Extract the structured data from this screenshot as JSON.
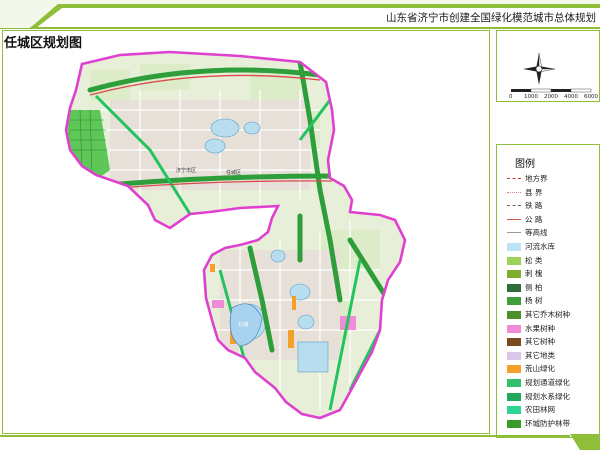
{
  "header": {
    "title": "山东省济宁市创建全国绿化模范城市总体规划"
  },
  "map": {
    "title": "任城区规划图",
    "place_labels": [
      "济宁市区",
      "任城区"
    ],
    "lake_label": "北湖"
  },
  "scale_bar": {
    "ticks": [
      "0",
      "1000",
      "2000",
      "4000",
      "6000"
    ]
  },
  "legend": {
    "title": "图例",
    "items": [
      {
        "label": "地方界",
        "kind": "line",
        "color": "#c0392b",
        "style": "dashed"
      },
      {
        "label": "县 界",
        "kind": "line",
        "color": "#c88",
        "style": "dotted"
      },
      {
        "label": "铁 路",
        "kind": "line",
        "color": "#666",
        "style": "dashed"
      },
      {
        "label": "公 路",
        "kind": "line",
        "color": "#d9534f",
        "style": "solid"
      },
      {
        "label": "等高线",
        "kind": "line",
        "color": "#999",
        "style": "solid"
      },
      {
        "label": "河流水库",
        "kind": "swatch",
        "color": "#bde3f4"
      },
      {
        "label": "松 类",
        "kind": "swatch",
        "color": "#9bd35b"
      },
      {
        "label": "刺 槐",
        "kind": "swatch",
        "color": "#7fae2f"
      },
      {
        "label": "侧 柏",
        "kind": "swatch",
        "color": "#2f6e3a"
      },
      {
        "label": "杨 树",
        "kind": "swatch",
        "color": "#3f9e3a"
      },
      {
        "label": "其它乔木树种",
        "kind": "swatch",
        "color": "#4b8f2a"
      },
      {
        "label": "水果树种",
        "kind": "swatch",
        "color": "#f08bd6"
      },
      {
        "label": "其它树种",
        "kind": "swatch",
        "color": "#7b4a1e"
      },
      {
        "label": "其它地类",
        "kind": "swatch",
        "color": "#d9c7e9"
      },
      {
        "label": "荒山绿化",
        "kind": "swatch",
        "color": "#f5a02a"
      },
      {
        "label": "规划通道绿化",
        "kind": "swatch",
        "color": "#33c06a"
      },
      {
        "label": "规划水系绿化",
        "kind": "swatch",
        "color": "#22a85c"
      },
      {
        "label": "农田林网",
        "kind": "swatch",
        "color": "#2fd392"
      },
      {
        "label": "环城防护林带",
        "kind": "swatch",
        "color": "#3a9a2a"
      }
    ]
  },
  "colors": {
    "accent": "#8fbf3a",
    "boundary": "#e040d0",
    "built_up": "#d9e8c9",
    "water": "#b8ddef",
    "green_corridor": "#2e9e3a"
  }
}
